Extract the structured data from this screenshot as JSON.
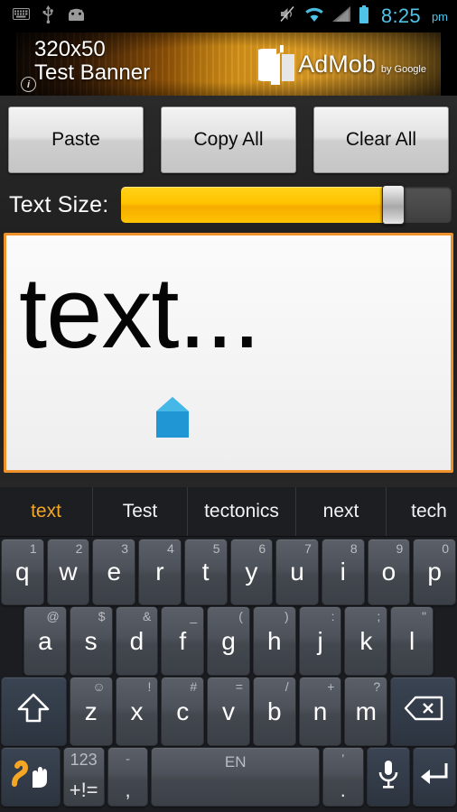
{
  "status_bar": {
    "icons_left": [
      "keyboard-icon",
      "usb-icon",
      "android-icon"
    ],
    "icons_right": [
      "mute-icon",
      "wifi-icon",
      "signal-icon",
      "battery-icon"
    ],
    "time": "8:25",
    "meridiem": "pm",
    "time_color": "#4fc3e8"
  },
  "ad_banner": {
    "title": "320x50",
    "subtitle": "Test Banner",
    "brand": "AdMob",
    "by": "by Google",
    "info_badge": "i"
  },
  "toolbar": {
    "paste_label": "Paste",
    "copy_all_label": "Copy All",
    "clear_all_label": "Clear All"
  },
  "text_size": {
    "label": "Text Size:",
    "value_percent": 81,
    "fill_color": "#ffc400",
    "track_color": "#4a4a4a"
  },
  "editor": {
    "text": "text...",
    "border_color": "#f0922b",
    "handle_color": "#2196d4"
  },
  "keyboard": {
    "suggestions": [
      {
        "label": "text",
        "active": true
      },
      {
        "label": "Test",
        "active": false
      },
      {
        "label": "tectonics",
        "active": false
      },
      {
        "label": "next",
        "active": false
      },
      {
        "label": "tech",
        "active": false
      }
    ],
    "row1": [
      {
        "key": "q",
        "sub": "1"
      },
      {
        "key": "w",
        "sub": "2"
      },
      {
        "key": "e",
        "sub": "3"
      },
      {
        "key": "r",
        "sub": "4"
      },
      {
        "key": "t",
        "sub": "5"
      },
      {
        "key": "y",
        "sub": "6"
      },
      {
        "key": "u",
        "sub": "7"
      },
      {
        "key": "i",
        "sub": "8"
      },
      {
        "key": "o",
        "sub": "9"
      },
      {
        "key": "p",
        "sub": "0"
      }
    ],
    "row2": [
      {
        "key": "a",
        "sub": "@"
      },
      {
        "key": "s",
        "sub": "$"
      },
      {
        "key": "d",
        "sub": "&"
      },
      {
        "key": "f",
        "sub": "_"
      },
      {
        "key": "g",
        "sub": "("
      },
      {
        "key": "h",
        "sub": ")"
      },
      {
        "key": "j",
        "sub": ":"
      },
      {
        "key": "k",
        "sub": ";"
      },
      {
        "key": "l",
        "sub": "\""
      }
    ],
    "row3": [
      {
        "key": "z",
        "sub": "☺"
      },
      {
        "key": "x",
        "sub": "!"
      },
      {
        "key": "c",
        "sub": "#"
      },
      {
        "key": "v",
        "sub": "="
      },
      {
        "key": "b",
        "sub": "/"
      },
      {
        "key": "n",
        "sub": "+"
      },
      {
        "key": "m",
        "sub": "?"
      }
    ],
    "shift_icon": "shift-arrow-icon",
    "backspace_icon": "backspace-icon",
    "swipe_icon": "swipe-gesture-icon",
    "numeric_top": "123",
    "numeric_bottom": "+!=",
    "comma_top": "-",
    "comma_bottom": ",",
    "space_label": "EN",
    "period_top": "'",
    "period_bottom": ".",
    "mic_icon": "microphone-icon",
    "enter_icon": "enter-arrow-icon"
  }
}
